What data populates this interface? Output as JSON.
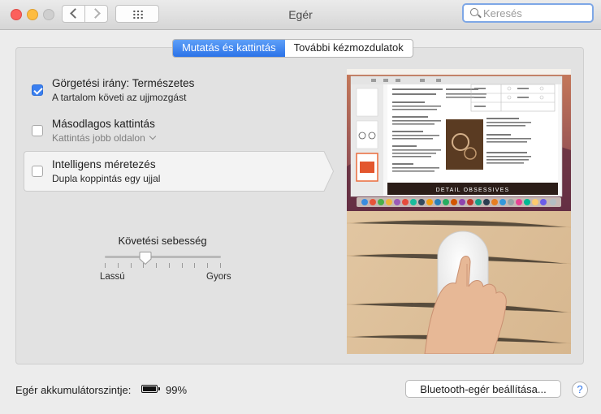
{
  "window": {
    "title": "Egér"
  },
  "search": {
    "placeholder": "Keresés"
  },
  "tabs": [
    {
      "label": "Mutatás és kattintás",
      "active": true
    },
    {
      "label": "További kézmozdulatok",
      "active": false
    }
  ],
  "options": [
    {
      "title": "Görgetési irány: Természetes",
      "subtitle": "A tartalom követi az ujjmozgást",
      "checked": true
    },
    {
      "title": "Másodlagos kattintás",
      "subtitle": "Kattintás jobb oldalon",
      "checked": false
    },
    {
      "title": "Intelligens méretezés",
      "subtitle": "Dupla koppintás egy ujjal",
      "checked": false
    }
  ],
  "tracking": {
    "title": "Követési sebesség",
    "min_label": "Lassú",
    "max_label": "Gyors",
    "level": 0.35,
    "tick_count": 10
  },
  "preview": {
    "banner": "DETAIL OBSESSIVES"
  },
  "footer": {
    "battery_label": "Egér akkumulátorszintje:",
    "battery_percent": "99%",
    "battery_level": 0.99,
    "bluetooth_button": "Bluetooth-egér beállítása...",
    "help": "?"
  },
  "colors": {
    "accent": "#2b72e8",
    "close": "#fc605c",
    "minimize": "#fdbc40"
  }
}
